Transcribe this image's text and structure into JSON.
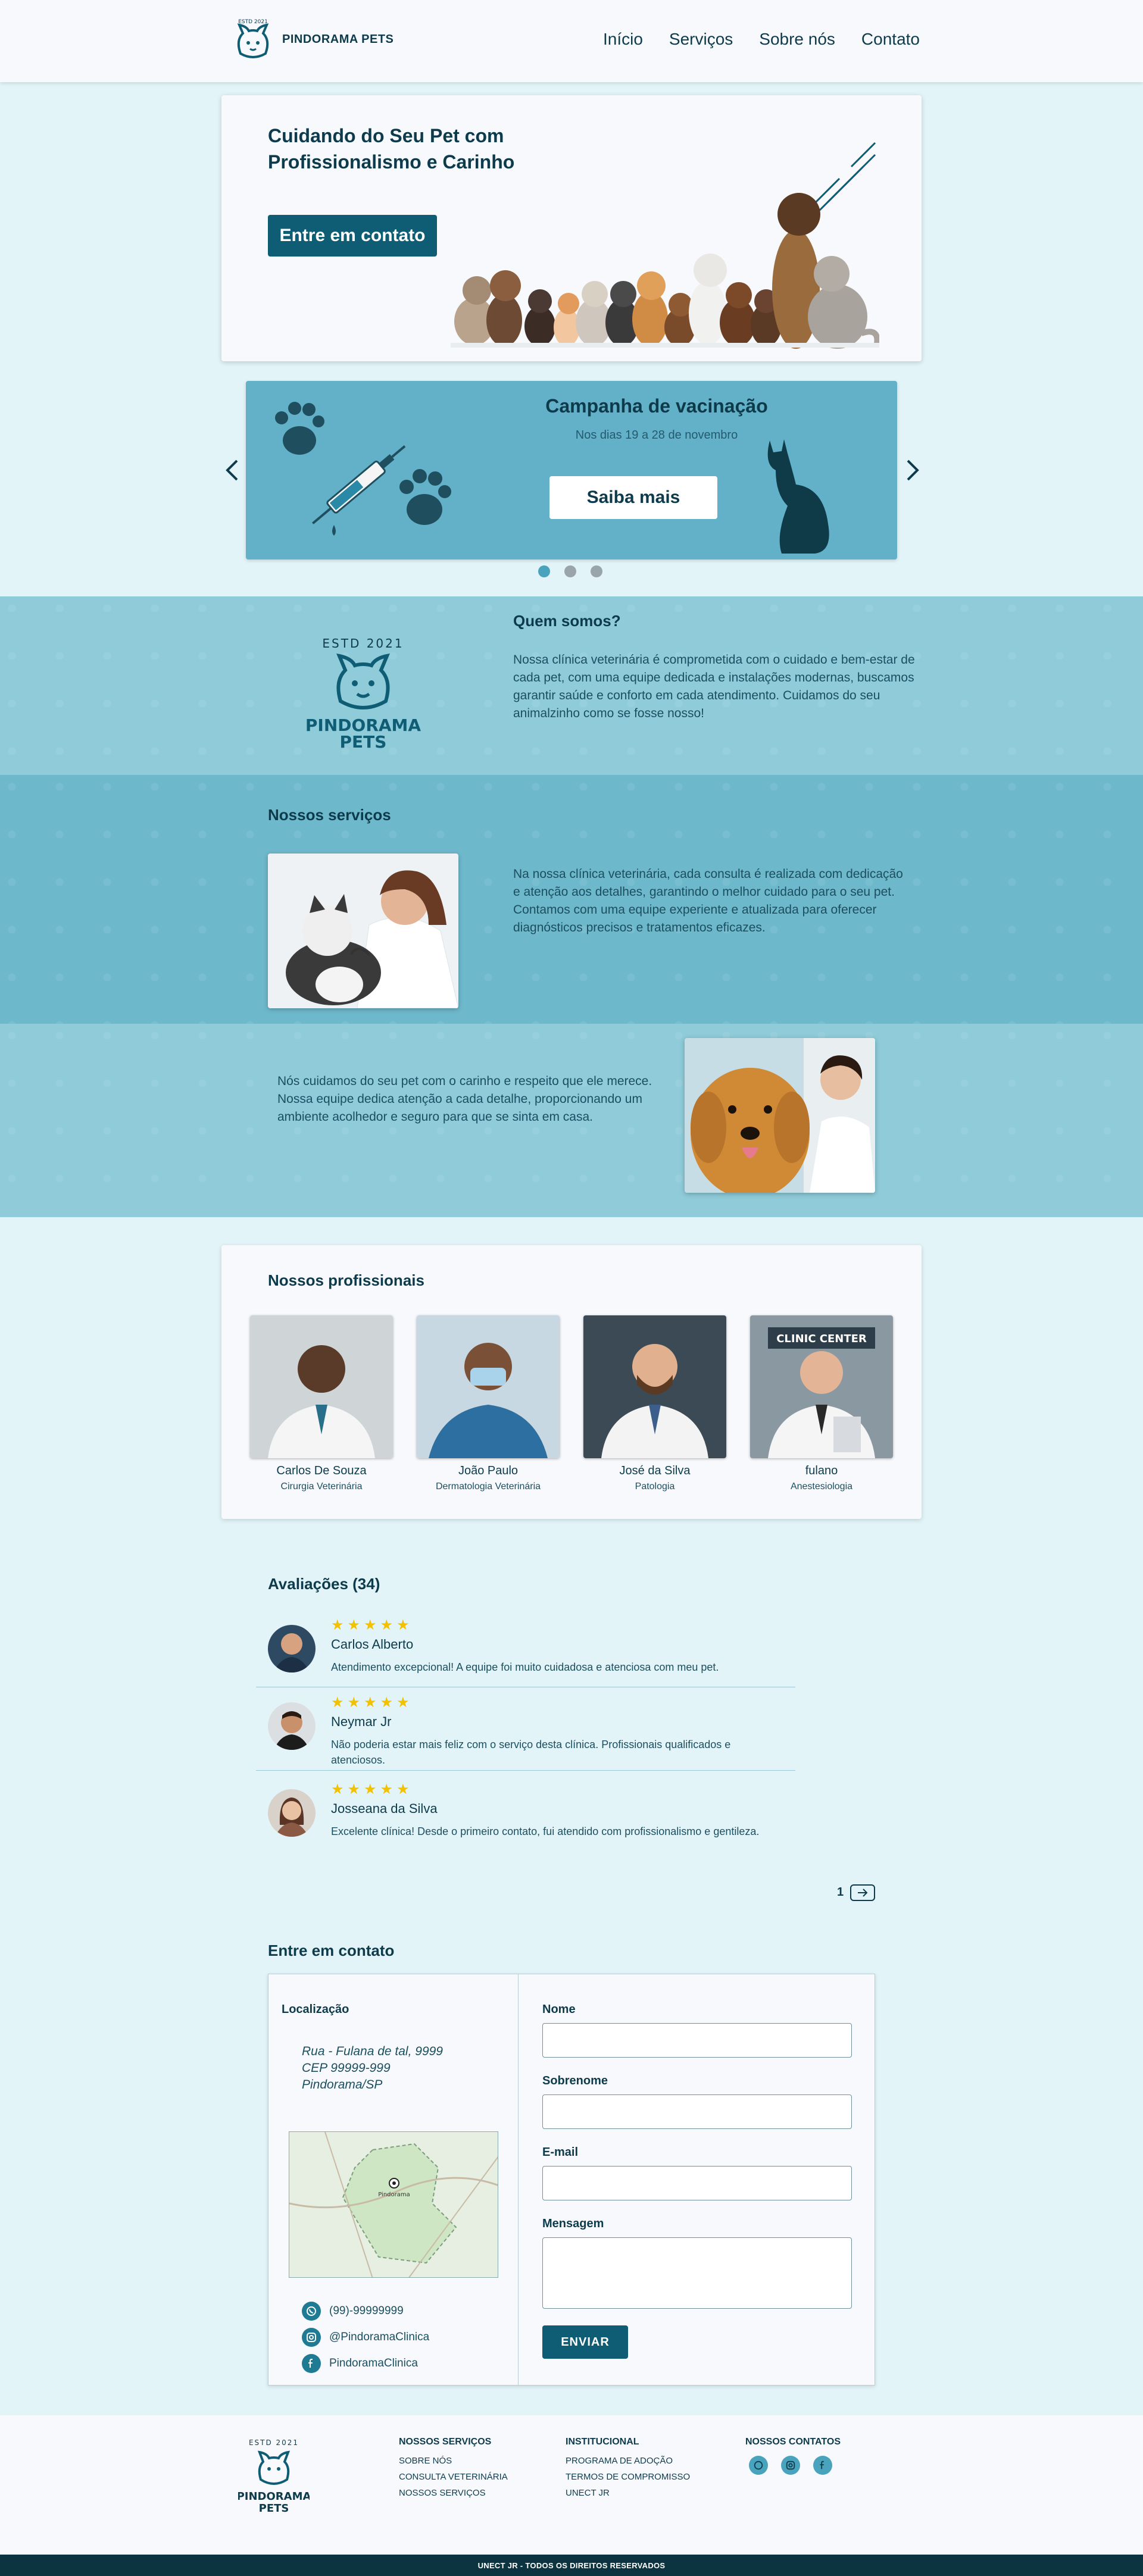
{
  "brand": {
    "name": "PINDORAMA PETS",
    "estd": "ESTD 2021",
    "logo_line1": "PINDORAMA",
    "logo_line2": "PETS"
  },
  "nav": [
    "Início",
    "Serviços",
    "Sobre nós",
    "Contato"
  ],
  "hero": {
    "title": "Cuidando do Seu Pet com Profissionalismo e Carinho",
    "cta": "Entre em contato"
  },
  "banner": {
    "title": "Campanha de vacinação",
    "subtitle": "Nos dias 19 a 28 de novembro",
    "cta": "Saiba mais",
    "prev_icon": "chevron-left-icon",
    "next_icon": "chevron-right-icon",
    "active_slide": 1,
    "slide_count": 3
  },
  "about": {
    "title": "Quem somos?",
    "text": "Nossa clínica veterinária é comprometida com o cuidado e bem-estar de cada pet, com uma equipe dedicada e instalações modernas, buscamos garantir saúde e conforto em cada atendimento. Cuidamos do seu animalzinho como se fosse nosso!"
  },
  "services": {
    "title": "Nossos serviços",
    "text1": "Na nossa clínica veterinária, cada consulta é realizada com dedicação e atenção aos detalhes, garantindo o melhor cuidado para o seu pet. Contamos com uma equipe experiente e atualizada para oferecer diagnósticos precisos e tratamentos eficazes.",
    "text2": "Nós cuidamos do seu pet com o carinho e respeito que ele merece. Nossa equipe dedica atenção a cada detalhe, proporcionando um ambiente acolhedor e seguro para que se sinta em casa."
  },
  "professionals": {
    "title": "Nossos profissionais",
    "items": [
      {
        "name": "Carlos De Souza",
        "role": "Cirurgia Veterinária"
      },
      {
        "name": "João Paulo",
        "role": "Dermatologia Veterinária"
      },
      {
        "name": "José da Silva",
        "role": "Patologia"
      },
      {
        "name": "fulano",
        "role": "Anestesiologia"
      }
    ],
    "sign_text": "CLINIC CENTER"
  },
  "reviews": {
    "title": "Avaliações (34)",
    "stars": "★★★★★",
    "items": [
      {
        "name": "Carlos Alberto",
        "text": "Atendimento excepcional! A equipe foi muito cuidadosa e atenciosa com meu pet.",
        "rating": 5
      },
      {
        "name": "Neymar Jr",
        "text": "Não poderia estar mais feliz com o serviço desta clínica. Profissionais qualificados e atenciosos.",
        "rating": 5
      },
      {
        "name": "Josseana da Silva",
        "text": "Excelente clínica! Desde o primeiro contato, fui atendido com profissionalismo e gentileza.",
        "rating": 5
      }
    ],
    "page": "1",
    "next_icon": "arrow-right-icon"
  },
  "contact": {
    "title": "Entre em contato",
    "location_label": "Localização",
    "address": [
      "Rua - Fulana de tal, 9999",
      "CEP 99999-999",
      "Pindorama/SP"
    ],
    "map_label": "Pindorama",
    "phone": "(99)-99999999",
    "instagram": "@PindoramaClinica",
    "facebook": "PindoramaClinica",
    "form": {
      "name_label": "Nome",
      "surname_label": "Sobrenome",
      "email_label": "E-mail",
      "message_label": "Mensagem",
      "submit": "ENVIAR"
    }
  },
  "footer": {
    "services": {
      "title": "NOSSOS SERVIÇOS",
      "links": [
        "SOBRE NÓS",
        "CONSULTA VETERINÁRIA",
        "NOSSOS SERVIÇOS"
      ]
    },
    "institutional": {
      "title": "INSTITUCIONAL",
      "links": [
        "PROGRAMA DE ADOÇÃO",
        "TERMOS DE COMPROMISSO",
        "UNECT JR"
      ]
    },
    "contacts": {
      "title": "NOSSOS CONTATOS"
    },
    "copyright": "UNECT JR - TODOS OS DIREITOS RESERVADOS"
  },
  "colors": {
    "page_bg": "#e2f4f8",
    "primary": "#0f5d74",
    "banner": "#63b1c8",
    "band_about": "#8fcbd9",
    "band_services": "#6eb8cc",
    "text_dark": "#0d3b4c",
    "stars": "#f2c200"
  }
}
